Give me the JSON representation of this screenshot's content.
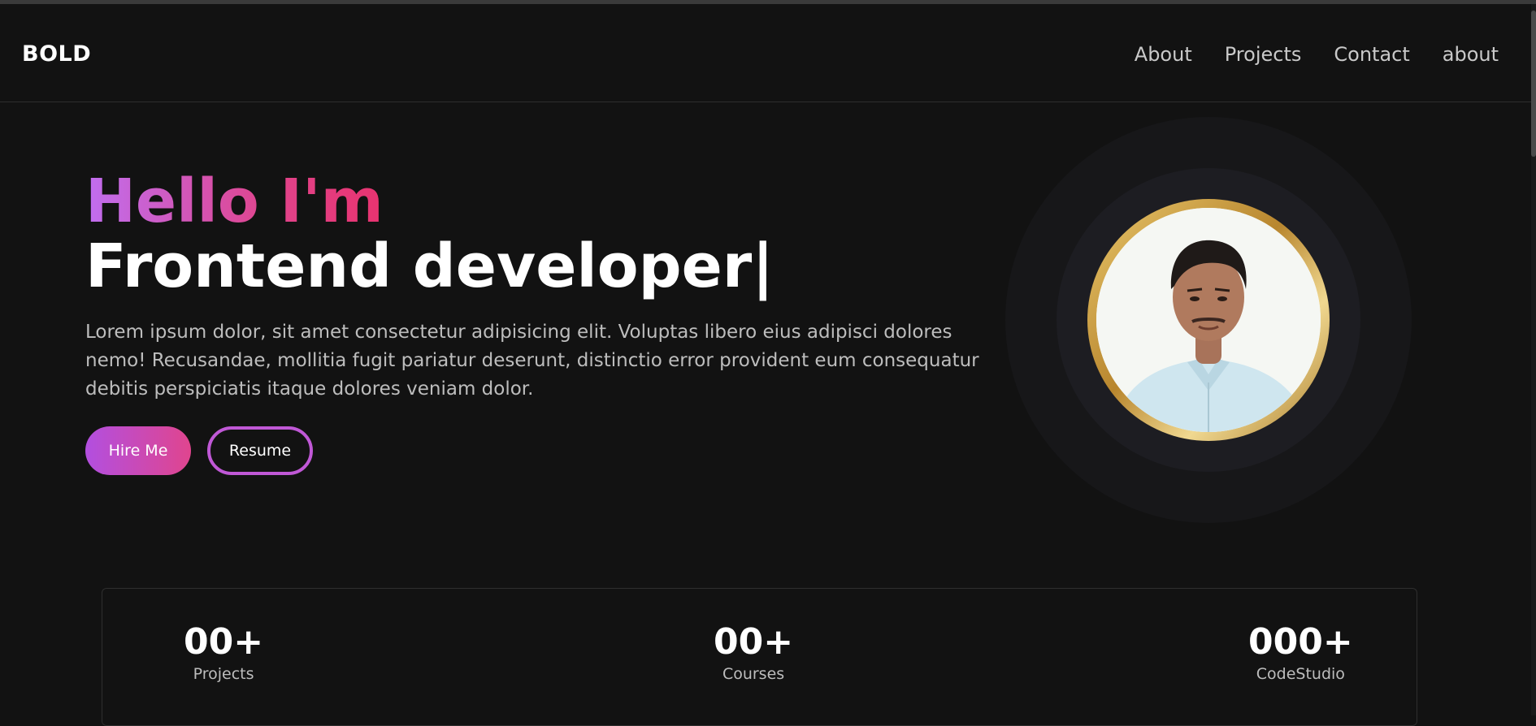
{
  "brand": "BOLD",
  "nav": {
    "items": [
      "About",
      "Projects",
      "Contact",
      "about"
    ]
  },
  "hero": {
    "greeting": "Hello I'm",
    "role": "Frontend developer",
    "cursor": "|",
    "description": "Lorem ipsum dolor, sit amet consectetur adipisicing elit. Voluptas libero eius adipisci dolores nemo! Recusandae, mollitia fugit pariatur deserunt, distinctio error provident eum consequatur debitis perspiciatis itaque dolores veniam dolor.",
    "hire_label": "Hire Me",
    "resume_label": "Resume"
  },
  "stats": [
    {
      "value": "00+",
      "label": "Projects"
    },
    {
      "value": "00+",
      "label": "Courses"
    },
    {
      "value": "000+",
      "label": "CodeStudio"
    }
  ],
  "colors": {
    "background": "#121212",
    "accent_start": "#c06ef0",
    "accent_end": "#e8336f",
    "ring_gold": "#d4a94a"
  },
  "icons": {
    "avatar": "profile-photo"
  }
}
